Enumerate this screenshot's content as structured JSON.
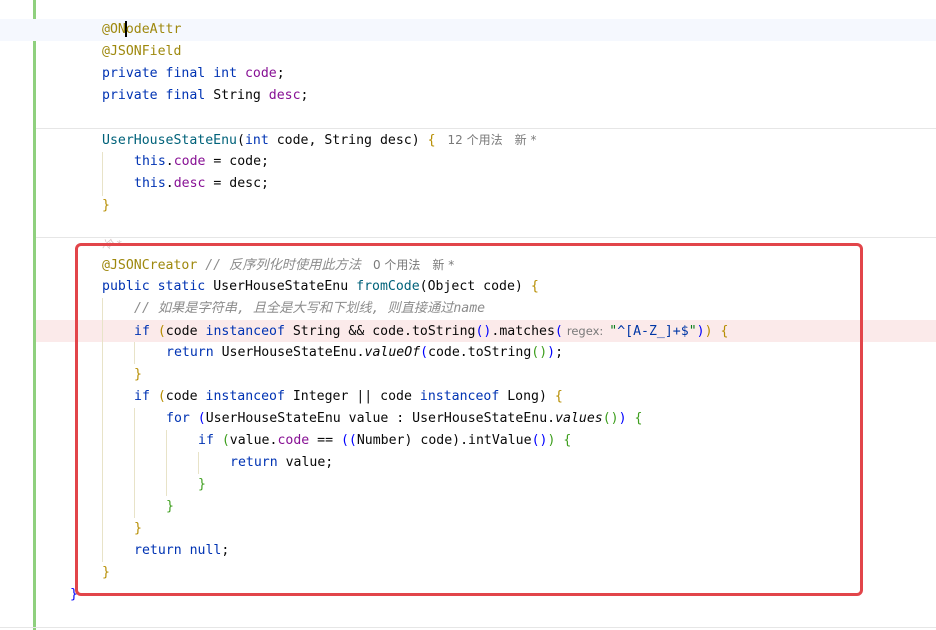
{
  "annotations": {
    "onode": "@ONodeAttr",
    "json_field": "@JSONField",
    "json_creator": "@JSONCreator"
  },
  "code": {
    "kw_private": "private",
    "kw_final": "final",
    "kw_int": "int",
    "type_string": "String",
    "field_code": "code",
    "field_desc": "desc",
    "semicolon": ";",
    "ctor_name": "UserHouseStateEnu",
    "ctor_params_a": "code, ",
    "ctor_params_b": " desc) ",
    "open_paren": "(",
    "open_brace": "{",
    "close_brace": "}",
    "close_brace_class": "}",
    "kw_this": "this",
    "this_code_rest": " = code;",
    "this_desc_rest": " = desc;",
    "comment_creator": "// 反序列化时使用此方法",
    "kw_public": "public",
    "kw_static": "static",
    "return_type": "UserHouseStateEnu",
    "method_fromcode": "fromCode",
    "param_object": "(Object code) ",
    "comment_string": "// 如果是字符串, 且全是大写和下划线, 则直接通过name",
    "kw_if": "if",
    "kw_instanceof": "instanceof",
    "if1_code": "code ",
    "if1_mid": " String && code.",
    "call_tostring": "toString",
    "paren_pair": "()",
    "dot": ".",
    "call_matches": "matches",
    "inlay_regex": "regex:",
    "regex_q": "\"",
    "regex_body": "^[A-Z_]+$",
    "kw_return": "return",
    "enum_prefix": "UserHouseStateEnu.",
    "call_valueof": "valueOf",
    "valueof_arg": "code.",
    "close_paren": ")",
    "if2_mid": " Integer || code ",
    "if2_type": " Long) ",
    "kw_for": "for",
    "for_var": "UserHouseStateEnu value : UserHouseStateEnu.",
    "call_values": "values",
    "if3_value": "value.",
    "if3_eq": " == ",
    "dbl_paren": "((",
    "type_number": "Number",
    "if3_code": ") code).",
    "call_intvalue": "intValue",
    "return_value": " value;",
    "kw_null": "null"
  },
  "hints": {
    "ctor_usages": "12 个用法",
    "ctor_new": "新 *",
    "method_usages": "0 个用法",
    "method_new": "新 *"
  },
  "faded_author": "冷 *"
}
